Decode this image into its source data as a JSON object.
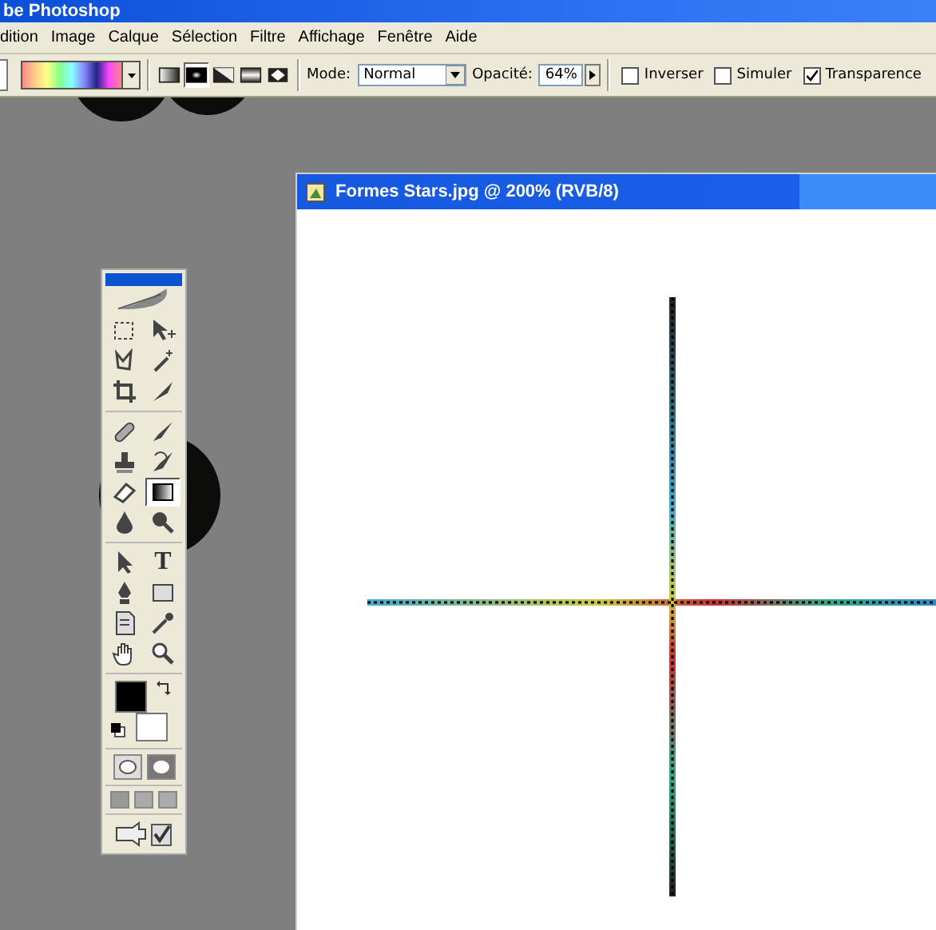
{
  "window": {
    "title": "be Photoshop"
  },
  "menu": [
    "dition",
    "Image",
    "Calque",
    "Sélection",
    "Filtre",
    "Affichage",
    "Fenêtre",
    "Aide"
  ],
  "options_bar": {
    "gradient_types": [
      {
        "kind": "linear",
        "selected": false
      },
      {
        "kind": "radial",
        "selected": true
      },
      {
        "kind": "angle",
        "selected": false
      },
      {
        "kind": "reflected",
        "selected": false
      },
      {
        "kind": "diamond",
        "selected": false
      }
    ],
    "mode": {
      "label": "Mode:",
      "value": "Normal"
    },
    "opacity": {
      "label": "Opacité:",
      "value": "64%"
    },
    "checkboxes": [
      {
        "label": "Inverser",
        "checked": false
      },
      {
        "label": "Simuler",
        "checked": false
      },
      {
        "label": "Transparence",
        "checked": true
      }
    ]
  },
  "toolbox": {
    "tool_groups": [
      [
        {
          "kind": "marquee",
          "selected": false
        },
        {
          "kind": "move",
          "selected": false
        },
        {
          "kind": "lasso",
          "selected": false
        },
        {
          "kind": "wand",
          "selected": false
        },
        {
          "kind": "crop",
          "selected": false
        },
        {
          "kind": "knife",
          "selected": false
        }
      ],
      [
        {
          "kind": "bandage",
          "selected": false
        },
        {
          "kind": "brush",
          "selected": false
        },
        {
          "kind": "stamp",
          "selected": false
        },
        {
          "kind": "history",
          "selected": false
        },
        {
          "kind": "eraser",
          "selected": false
        },
        {
          "kind": "gradient",
          "selected": true
        },
        {
          "kind": "drop",
          "selected": false
        },
        {
          "kind": "burn",
          "selected": false
        }
      ],
      [
        {
          "kind": "arrow",
          "selected": false
        },
        {
          "kind": "type",
          "glyph": "T",
          "selected": false
        },
        {
          "kind": "pen",
          "selected": false
        },
        {
          "kind": "rectangle",
          "selected": false
        },
        {
          "kind": "note",
          "selected": false
        },
        {
          "kind": "eyedropper",
          "selected": false
        },
        {
          "kind": "hand",
          "selected": false
        },
        {
          "kind": "zoom",
          "selected": false
        }
      ]
    ],
    "foreground": {
      "color": "#000000"
    },
    "background": {
      "color": "#ffffff"
    }
  },
  "document": {
    "title": "Formes Stars.jpg @ 200% (RVB/8)"
  }
}
